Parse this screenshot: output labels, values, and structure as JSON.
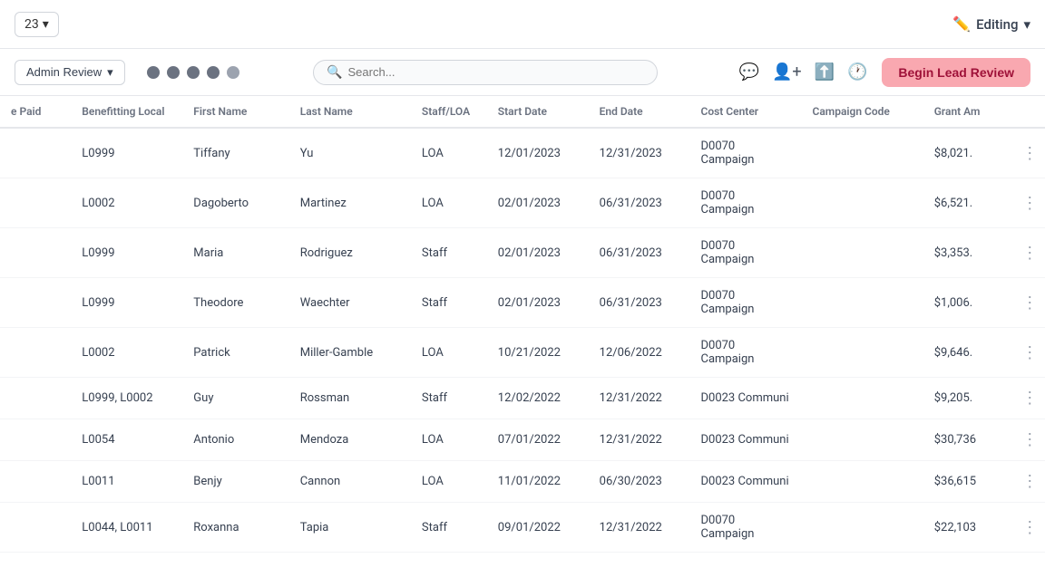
{
  "topbar": {
    "year": "23",
    "year_label": "23",
    "chevron_down": "▾",
    "editing_label": "Editing",
    "pencil_icon": "✏️"
  },
  "subheader": {
    "admin_review_label": "Admin Review",
    "begin_review_label": "Begin Lead Review",
    "search_placeholder": "Search...",
    "steps": [
      {
        "id": 1,
        "active": true
      },
      {
        "id": 2,
        "active": true
      },
      {
        "id": 3,
        "active": true
      },
      {
        "id": 4,
        "active": true
      },
      {
        "id": 5,
        "active": false
      }
    ]
  },
  "table": {
    "columns": [
      {
        "key": "paid",
        "label": "e Paid"
      },
      {
        "key": "ben_local",
        "label": "Benefitting Local"
      },
      {
        "key": "first_name",
        "label": "First Name"
      },
      {
        "key": "last_name",
        "label": "Last Name"
      },
      {
        "key": "staff_loa",
        "label": "Staff/LOA"
      },
      {
        "key": "start_date",
        "label": "Start Date"
      },
      {
        "key": "end_date",
        "label": "End Date"
      },
      {
        "key": "cost_center",
        "label": "Cost Center"
      },
      {
        "key": "campaign_code",
        "label": "Campaign Code"
      },
      {
        "key": "grant_am",
        "label": "Grant Am"
      }
    ],
    "rows": [
      {
        "paid": "",
        "ben_local": "L0999",
        "first_name": "Tiffany",
        "last_name": "Yu",
        "staff_loa": "LOA",
        "start_date": "12/01/2023",
        "end_date": "12/31/2023",
        "cost_center": "D0070 Campaign",
        "campaign_code": "",
        "grant_am": "$8,021."
      },
      {
        "paid": "",
        "ben_local": "L0002",
        "first_name": "Dagoberto",
        "last_name": "Martinez",
        "staff_loa": "LOA",
        "start_date": "02/01/2023",
        "end_date": "06/31/2023",
        "cost_center": "D0070 Campaign",
        "campaign_code": "",
        "grant_am": "$6,521."
      },
      {
        "paid": "",
        "ben_local": "L0999",
        "first_name": "Maria",
        "last_name": "Rodriguez",
        "staff_loa": "Staff",
        "start_date": "02/01/2023",
        "end_date": "06/31/2023",
        "cost_center": "D0070 Campaign",
        "campaign_code": "",
        "grant_am": "$3,353."
      },
      {
        "paid": "",
        "ben_local": "L0999",
        "first_name": "Theodore",
        "last_name": "Waechter",
        "staff_loa": "Staff",
        "start_date": "02/01/2023",
        "end_date": "06/31/2023",
        "cost_center": "D0070 Campaign",
        "campaign_code": "",
        "grant_am": "$1,006."
      },
      {
        "paid": "",
        "ben_local": "L0002",
        "first_name": "Patrick",
        "last_name": "Miller-Gamble",
        "staff_loa": "LOA",
        "start_date": "10/21/2022",
        "end_date": "12/06/2022",
        "cost_center": "D0070 Campaign",
        "campaign_code": "",
        "grant_am": "$9,646."
      },
      {
        "paid": "",
        "ben_local": "L0999, L0002",
        "first_name": "Guy",
        "last_name": "Rossman",
        "staff_loa": "Staff",
        "start_date": "12/02/2022",
        "end_date": "12/31/2022",
        "cost_center": "D0023 Communi",
        "campaign_code": "",
        "grant_am": "$9,205."
      },
      {
        "paid": "",
        "ben_local": "L0054",
        "first_name": "Antonio",
        "last_name": "Mendoza",
        "staff_loa": "LOA",
        "start_date": "07/01/2022",
        "end_date": "12/31/2022",
        "cost_center": "D0023 Communi",
        "campaign_code": "",
        "grant_am": "$30,736"
      },
      {
        "paid": "",
        "ben_local": "L0011",
        "first_name": "Benjy",
        "last_name": "Cannon",
        "staff_loa": "LOA",
        "start_date": "11/01/2022",
        "end_date": "06/30/2023",
        "cost_center": "D0023 Communi",
        "campaign_code": "",
        "grant_am": "$36,615"
      },
      {
        "paid": "",
        "ben_local": "L0044, L0011",
        "first_name": "Roxanna",
        "last_name": "Tapia",
        "staff_loa": "Staff",
        "start_date": "09/01/2022",
        "end_date": "12/31/2022",
        "cost_center": "D0070 Campaign",
        "campaign_code": "",
        "grant_am": "$22,103"
      }
    ]
  }
}
